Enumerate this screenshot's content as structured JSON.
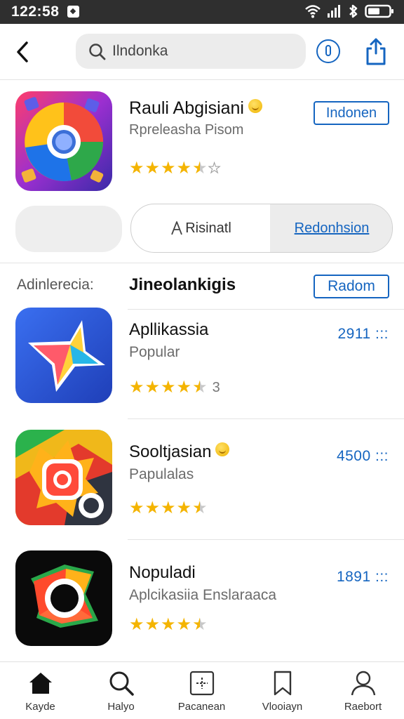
{
  "status_bar": {
    "time": "122:58"
  },
  "header": {
    "search_text": "Ilndonka"
  },
  "featured": {
    "title": "Rauli Abgisiani",
    "subtitle": "Rpreleasha Pisom",
    "badge": "Indonen",
    "segment_left": "Risinatl",
    "segment_right": "Redonhsion"
  },
  "section": {
    "label": "Adinlerecia:",
    "title": "Jineolankigis",
    "button": "Radom"
  },
  "apps": [
    {
      "name": "Apllikassia",
      "subtitle": "Popular",
      "price": "2911 :::",
      "rating_count": "3"
    },
    {
      "name": "Sooltjasian",
      "subtitle": "Papulalas",
      "price": "4500 :::"
    },
    {
      "name": "Nopuladi",
      "subtitle": "Aplcikasiia Enslaraaca",
      "price": "1891 :::"
    }
  ],
  "nav": [
    {
      "label": "Kayde",
      "icon": "home-icon"
    },
    {
      "label": "Halyo",
      "icon": "search-icon"
    },
    {
      "label": "Pacanean",
      "icon": "apps-icon"
    },
    {
      "label": "Vlooiayn",
      "icon": "bookmark-icon"
    },
    {
      "label": "Raebort",
      "icon": "profile-icon"
    }
  ],
  "colors": {
    "accent": "#1565c0",
    "star": "#f4b400",
    "status_bar": "#2f2f2f"
  }
}
